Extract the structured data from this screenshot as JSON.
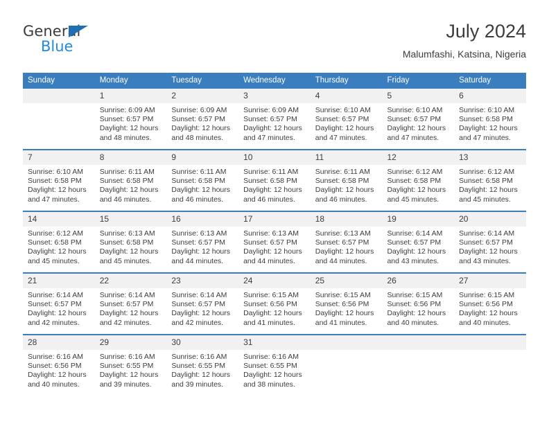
{
  "brand": {
    "name_part1": "General",
    "name_part2": "Blue",
    "triangle_color": "#1f6fb5",
    "blue_color": "#1f8ade",
    "gray_color": "#3b3b3b"
  },
  "header": {
    "title": "July 2024",
    "subtitle": "Malumfashi, Katsina, Nigeria"
  },
  "theme": {
    "header_bar_color": "#3b7ec0",
    "day_number_band_color": "#f1f1f1",
    "text_color": "#3c3c3c",
    "row_separator_color": "#3b7ec0"
  },
  "weekday_headers": [
    "Sunday",
    "Monday",
    "Tuesday",
    "Wednesday",
    "Thursday",
    "Friday",
    "Saturday"
  ],
  "weeks": [
    [
      {
        "day": "",
        "sunrise": "",
        "sunset": "",
        "daylight1": "",
        "daylight2": ""
      },
      {
        "day": "1",
        "sunrise": "Sunrise: 6:09 AM",
        "sunset": "Sunset: 6:57 PM",
        "daylight1": "Daylight: 12 hours",
        "daylight2": "and 48 minutes."
      },
      {
        "day": "2",
        "sunrise": "Sunrise: 6:09 AM",
        "sunset": "Sunset: 6:57 PM",
        "daylight1": "Daylight: 12 hours",
        "daylight2": "and 48 minutes."
      },
      {
        "day": "3",
        "sunrise": "Sunrise: 6:09 AM",
        "sunset": "Sunset: 6:57 PM",
        "daylight1": "Daylight: 12 hours",
        "daylight2": "and 47 minutes."
      },
      {
        "day": "4",
        "sunrise": "Sunrise: 6:10 AM",
        "sunset": "Sunset: 6:57 PM",
        "daylight1": "Daylight: 12 hours",
        "daylight2": "and 47 minutes."
      },
      {
        "day": "5",
        "sunrise": "Sunrise: 6:10 AM",
        "sunset": "Sunset: 6:57 PM",
        "daylight1": "Daylight: 12 hours",
        "daylight2": "and 47 minutes."
      },
      {
        "day": "6",
        "sunrise": "Sunrise: 6:10 AM",
        "sunset": "Sunset: 6:58 PM",
        "daylight1": "Daylight: 12 hours",
        "daylight2": "and 47 minutes."
      }
    ],
    [
      {
        "day": "7",
        "sunrise": "Sunrise: 6:10 AM",
        "sunset": "Sunset: 6:58 PM",
        "daylight1": "Daylight: 12 hours",
        "daylight2": "and 47 minutes."
      },
      {
        "day": "8",
        "sunrise": "Sunrise: 6:11 AM",
        "sunset": "Sunset: 6:58 PM",
        "daylight1": "Daylight: 12 hours",
        "daylight2": "and 46 minutes."
      },
      {
        "day": "9",
        "sunrise": "Sunrise: 6:11 AM",
        "sunset": "Sunset: 6:58 PM",
        "daylight1": "Daylight: 12 hours",
        "daylight2": "and 46 minutes."
      },
      {
        "day": "10",
        "sunrise": "Sunrise: 6:11 AM",
        "sunset": "Sunset: 6:58 PM",
        "daylight1": "Daylight: 12 hours",
        "daylight2": "and 46 minutes."
      },
      {
        "day": "11",
        "sunrise": "Sunrise: 6:11 AM",
        "sunset": "Sunset: 6:58 PM",
        "daylight1": "Daylight: 12 hours",
        "daylight2": "and 46 minutes."
      },
      {
        "day": "12",
        "sunrise": "Sunrise: 6:12 AM",
        "sunset": "Sunset: 6:58 PM",
        "daylight1": "Daylight: 12 hours",
        "daylight2": "and 45 minutes."
      },
      {
        "day": "13",
        "sunrise": "Sunrise: 6:12 AM",
        "sunset": "Sunset: 6:58 PM",
        "daylight1": "Daylight: 12 hours",
        "daylight2": "and 45 minutes."
      }
    ],
    [
      {
        "day": "14",
        "sunrise": "Sunrise: 6:12 AM",
        "sunset": "Sunset: 6:58 PM",
        "daylight1": "Daylight: 12 hours",
        "daylight2": "and 45 minutes."
      },
      {
        "day": "15",
        "sunrise": "Sunrise: 6:13 AM",
        "sunset": "Sunset: 6:58 PM",
        "daylight1": "Daylight: 12 hours",
        "daylight2": "and 45 minutes."
      },
      {
        "day": "16",
        "sunrise": "Sunrise: 6:13 AM",
        "sunset": "Sunset: 6:57 PM",
        "daylight1": "Daylight: 12 hours",
        "daylight2": "and 44 minutes."
      },
      {
        "day": "17",
        "sunrise": "Sunrise: 6:13 AM",
        "sunset": "Sunset: 6:57 PM",
        "daylight1": "Daylight: 12 hours",
        "daylight2": "and 44 minutes."
      },
      {
        "day": "18",
        "sunrise": "Sunrise: 6:13 AM",
        "sunset": "Sunset: 6:57 PM",
        "daylight1": "Daylight: 12 hours",
        "daylight2": "and 44 minutes."
      },
      {
        "day": "19",
        "sunrise": "Sunrise: 6:14 AM",
        "sunset": "Sunset: 6:57 PM",
        "daylight1": "Daylight: 12 hours",
        "daylight2": "and 43 minutes."
      },
      {
        "day": "20",
        "sunrise": "Sunrise: 6:14 AM",
        "sunset": "Sunset: 6:57 PM",
        "daylight1": "Daylight: 12 hours",
        "daylight2": "and 43 minutes."
      }
    ],
    [
      {
        "day": "21",
        "sunrise": "Sunrise: 6:14 AM",
        "sunset": "Sunset: 6:57 PM",
        "daylight1": "Daylight: 12 hours",
        "daylight2": "and 42 minutes."
      },
      {
        "day": "22",
        "sunrise": "Sunrise: 6:14 AM",
        "sunset": "Sunset: 6:57 PM",
        "daylight1": "Daylight: 12 hours",
        "daylight2": "and 42 minutes."
      },
      {
        "day": "23",
        "sunrise": "Sunrise: 6:14 AM",
        "sunset": "Sunset: 6:57 PM",
        "daylight1": "Daylight: 12 hours",
        "daylight2": "and 42 minutes."
      },
      {
        "day": "24",
        "sunrise": "Sunrise: 6:15 AM",
        "sunset": "Sunset: 6:56 PM",
        "daylight1": "Daylight: 12 hours",
        "daylight2": "and 41 minutes."
      },
      {
        "day": "25",
        "sunrise": "Sunrise: 6:15 AM",
        "sunset": "Sunset: 6:56 PM",
        "daylight1": "Daylight: 12 hours",
        "daylight2": "and 41 minutes."
      },
      {
        "day": "26",
        "sunrise": "Sunrise: 6:15 AM",
        "sunset": "Sunset: 6:56 PM",
        "daylight1": "Daylight: 12 hours",
        "daylight2": "and 40 minutes."
      },
      {
        "day": "27",
        "sunrise": "Sunrise: 6:15 AM",
        "sunset": "Sunset: 6:56 PM",
        "daylight1": "Daylight: 12 hours",
        "daylight2": "and 40 minutes."
      }
    ],
    [
      {
        "day": "28",
        "sunrise": "Sunrise: 6:16 AM",
        "sunset": "Sunset: 6:56 PM",
        "daylight1": "Daylight: 12 hours",
        "daylight2": "and 40 minutes."
      },
      {
        "day": "29",
        "sunrise": "Sunrise: 6:16 AM",
        "sunset": "Sunset: 6:55 PM",
        "daylight1": "Daylight: 12 hours",
        "daylight2": "and 39 minutes."
      },
      {
        "day": "30",
        "sunrise": "Sunrise: 6:16 AM",
        "sunset": "Sunset: 6:55 PM",
        "daylight1": "Daylight: 12 hours",
        "daylight2": "and 39 minutes."
      },
      {
        "day": "31",
        "sunrise": "Sunrise: 6:16 AM",
        "sunset": "Sunset: 6:55 PM",
        "daylight1": "Daylight: 12 hours",
        "daylight2": "and 38 minutes."
      },
      {
        "day": "",
        "sunrise": "",
        "sunset": "",
        "daylight1": "",
        "daylight2": ""
      },
      {
        "day": "",
        "sunrise": "",
        "sunset": "",
        "daylight1": "",
        "daylight2": ""
      },
      {
        "day": "",
        "sunrise": "",
        "sunset": "",
        "daylight1": "",
        "daylight2": ""
      }
    ]
  ]
}
